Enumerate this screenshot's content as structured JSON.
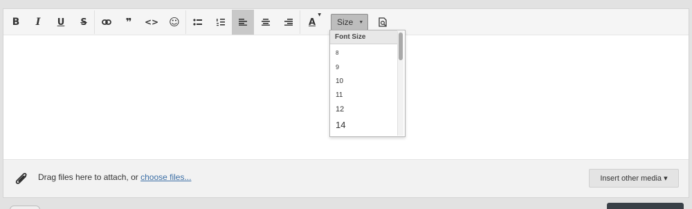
{
  "toolbar": {
    "buttons": [
      {
        "name": "bold-button",
        "glyph": "B"
      },
      {
        "name": "italic-button",
        "glyph": "I"
      },
      {
        "name": "underline-button",
        "glyph": "U"
      },
      {
        "name": "strikethrough-button",
        "glyph": "S"
      },
      {
        "name": "link-button",
        "icon": "link-icon"
      },
      {
        "name": "quote-button",
        "glyph": "❞"
      },
      {
        "name": "code-button",
        "glyph": "<>"
      },
      {
        "name": "emoji-button",
        "glyph": "☺"
      },
      {
        "name": "bulleted-list-button",
        "icon": "bulleted-list-icon"
      },
      {
        "name": "numbered-list-button",
        "icon": "numbered-list-icon"
      },
      {
        "name": "align-left-button",
        "icon": "align-left-icon"
      },
      {
        "name": "align-center-button",
        "icon": "align-center-icon"
      },
      {
        "name": "align-right-button",
        "icon": "align-right-icon"
      },
      {
        "name": "text-color-button",
        "glyph": "A"
      }
    ],
    "size_label": "Size"
  },
  "font_size_dropdown": {
    "header": "Font Size",
    "options": [
      "8",
      "9",
      "10",
      "11",
      "12",
      "14"
    ]
  },
  "footer": {
    "attach_text": "Drag files here to attach, or",
    "choose_link": "choose files...",
    "insert_media_label": "Insert other media ▾"
  },
  "colors": {
    "active_button": "#c8c8c8",
    "link": "#3b6ea5",
    "dark_button": "#394047"
  }
}
